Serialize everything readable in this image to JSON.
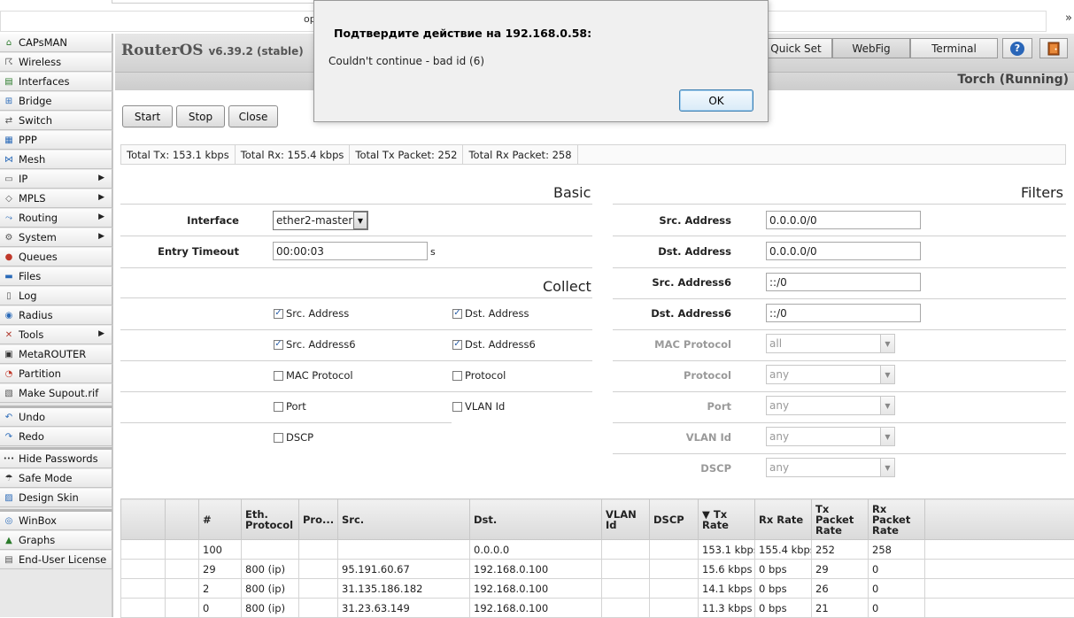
{
  "browser": {
    "partial_text": "ор",
    "overflow": "»"
  },
  "app": {
    "brand": "RouterOS",
    "version": "v6.39.2 (stable)",
    "page_title": "Torch (Running)"
  },
  "header_buttons": {
    "quick_set": "Quick Set",
    "webfig": "WebFig",
    "terminal": "Terminal",
    "help": "?"
  },
  "sidebar": {
    "group1": [
      {
        "label": "CAPsMAN",
        "icon": "capsman-icon"
      },
      {
        "label": "Wireless",
        "icon": "wireless-icon"
      },
      {
        "label": "Interfaces",
        "icon": "interfaces-icon"
      },
      {
        "label": "Bridge",
        "icon": "bridge-icon"
      },
      {
        "label": "Switch",
        "icon": "switch-icon"
      },
      {
        "label": "PPP",
        "icon": "ppp-icon"
      },
      {
        "label": "Mesh",
        "icon": "mesh-icon"
      },
      {
        "label": "IP",
        "icon": "ip-icon",
        "submenu": true
      },
      {
        "label": "MPLS",
        "icon": "mpls-icon",
        "submenu": true
      },
      {
        "label": "Routing",
        "icon": "routing-icon",
        "submenu": true
      },
      {
        "label": "System",
        "icon": "gear-icon",
        "submenu": true
      },
      {
        "label": "Queues",
        "icon": "queues-icon"
      },
      {
        "label": "Files",
        "icon": "files-icon"
      },
      {
        "label": "Log",
        "icon": "log-icon"
      },
      {
        "label": "Radius",
        "icon": "radius-icon"
      },
      {
        "label": "Tools",
        "icon": "tools-icon",
        "submenu": true
      },
      {
        "label": "MetaROUTER",
        "icon": "metarouter-icon"
      },
      {
        "label": "Partition",
        "icon": "partition-icon"
      },
      {
        "label": "Make Supout.rif",
        "icon": "supout-icon"
      }
    ],
    "group2": [
      {
        "label": "Undo",
        "icon": "undo-icon"
      },
      {
        "label": "Redo",
        "icon": "redo-icon"
      }
    ],
    "group3": [
      {
        "label": "Hide Passwords",
        "icon": "password-icon"
      },
      {
        "label": "Safe Mode",
        "icon": "umbrella-icon"
      },
      {
        "label": "Design Skin",
        "icon": "skin-icon"
      }
    ],
    "group4": [
      {
        "label": "WinBox",
        "icon": "winbox-icon"
      },
      {
        "label": "Graphs",
        "icon": "graphs-icon"
      },
      {
        "label": "End-User License",
        "icon": "license-icon"
      }
    ]
  },
  "actions": {
    "start": "Start",
    "stop": "Stop",
    "close": "Close"
  },
  "totals": {
    "tx": "Total Tx: 153.1 kbps",
    "rx": "Total Rx: 155.4 kbps",
    "tx_packet": "Total Tx Packet: 252",
    "rx_packet": "Total Rx Packet: 258"
  },
  "basic": {
    "title": "Basic",
    "interface_label": "Interface",
    "interface_value": "ether2-master",
    "timeout_label": "Entry Timeout",
    "timeout_value": "00:00:03",
    "timeout_unit": "s"
  },
  "collect": {
    "title": "Collect",
    "src_address": {
      "label": "Src. Address",
      "checked": true
    },
    "dst_address": {
      "label": "Dst. Address",
      "checked": true
    },
    "src_address6": {
      "label": "Src. Address6",
      "checked": true
    },
    "dst_address6": {
      "label": "Dst. Address6",
      "checked": true
    },
    "mac_protocol": {
      "label": "MAC Protocol",
      "checked": false
    },
    "protocol": {
      "label": "Protocol",
      "checked": false
    },
    "port": {
      "label": "Port",
      "checked": false
    },
    "vlan_id": {
      "label": "VLAN Id",
      "checked": false
    },
    "dscp": {
      "label": "DSCP",
      "checked": false
    }
  },
  "filters": {
    "title": "Filters",
    "src_address": {
      "label": "Src. Address",
      "value": "0.0.0.0/0"
    },
    "dst_address": {
      "label": "Dst. Address",
      "value": "0.0.0.0/0"
    },
    "src_address6": {
      "label": "Src. Address6",
      "value": "::/0"
    },
    "dst_address6": {
      "label": "Dst. Address6",
      "value": "::/0"
    },
    "mac_protocol": {
      "label": "MAC Protocol",
      "value": "all"
    },
    "protocol": {
      "label": "Protocol",
      "value": "any"
    },
    "port": {
      "label": "Port",
      "value": "any"
    },
    "vlan_id": {
      "label": "VLAN Id",
      "value": "any"
    },
    "dscp": {
      "label": "DSCP",
      "value": "any"
    }
  },
  "table": {
    "headers": [
      "",
      "",
      "#",
      "Eth.\nProtocol",
      "Pro...",
      "Src.",
      "Dst.",
      "VLAN\nId",
      "DSCP",
      "▼ Tx\nRate",
      "Rx Rate",
      "Tx\nPacket\nRate",
      "Rx\nPacket\nRate",
      ""
    ],
    "rows": [
      [
        "",
        "",
        "100",
        "",
        "",
        "",
        "0.0.0.0",
        "",
        "",
        "153.1 kbps",
        "155.4 kbps",
        "252",
        "258",
        ""
      ],
      [
        "",
        "",
        "29",
        "800 (ip)",
        "",
        "95.191.60.67",
        "192.168.0.100",
        "",
        "",
        "15.6 kbps",
        "0 bps",
        "29",
        "0",
        ""
      ],
      [
        "",
        "",
        "2",
        "800 (ip)",
        "",
        "31.135.186.182",
        "192.168.0.100",
        "",
        "",
        "14.1 kbps",
        "0 bps",
        "26",
        "0",
        ""
      ],
      [
        "",
        "",
        "0",
        "800 (ip)",
        "",
        "31.23.63.149",
        "192.168.0.100",
        "",
        "",
        "11.3 kbps",
        "0 bps",
        "21",
        "0",
        ""
      ]
    ]
  },
  "dialog": {
    "title": "Подтвердите действие на 192.168.0.58:",
    "message": "Couldn't continue - bad id (6)",
    "ok": "OK"
  }
}
